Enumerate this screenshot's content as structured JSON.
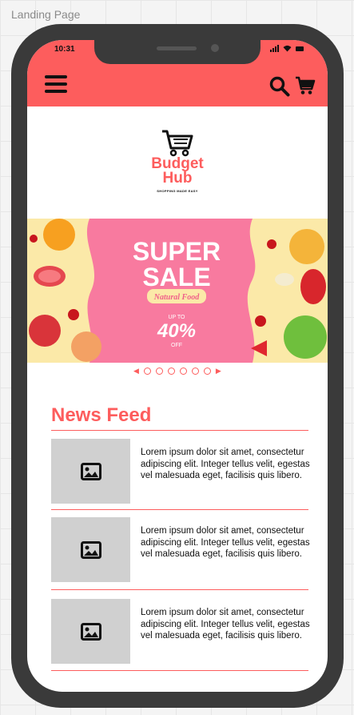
{
  "canvas": {
    "label": "Landing Page"
  },
  "status_bar": {
    "time": "10:31"
  },
  "header": {
    "menu_icon": "hamburger-icon",
    "search_icon": "search-icon",
    "cart_icon": "cart-icon",
    "color": "#fd5d5d"
  },
  "logo": {
    "icon": "cart-icon",
    "line1": "Budget",
    "line2": "Hub",
    "tagline": "SHOPPING MADE EASY"
  },
  "banner": {
    "headline1": "SUPER",
    "headline2": "SALE",
    "ribbon": "Natural Food",
    "upto": "UP TO",
    "discount": "40%",
    "off": "OFF"
  },
  "carousel": {
    "dot_count": 6,
    "prev_icon": "arrow-left-icon",
    "next_icon": "arrow-right-icon"
  },
  "news_feed": {
    "title": "News Feed",
    "items": [
      {
        "image_icon": "image-icon",
        "text": "Lorem ipsum dolor sit amet, consectetur adipiscing elit. Integer tellus velit, egestas vel malesuada eget, facilisis quis libero."
      },
      {
        "image_icon": "image-icon",
        "text": "Lorem ipsum dolor sit amet, consectetur adipiscing elit. Integer tellus velit, egestas vel malesuada eget, facilisis quis libero."
      },
      {
        "image_icon": "image-icon",
        "text": "Lorem ipsum dolor sit amet, consectetur adipiscing elit. Integer tellus velit, egestas vel malesuada eget, facilisis quis libero."
      }
    ]
  }
}
